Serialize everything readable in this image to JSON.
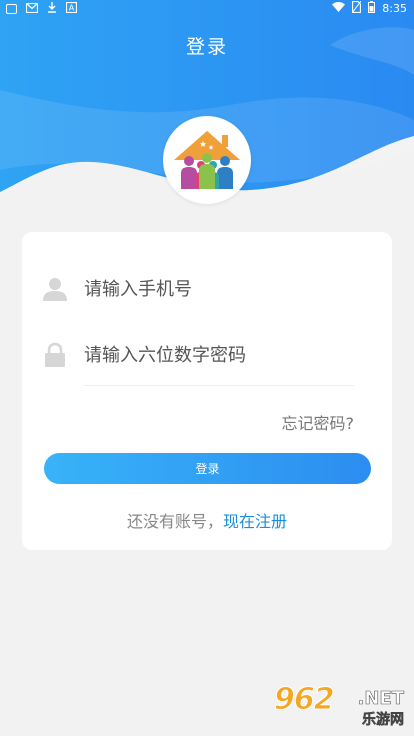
{
  "statusbar": {
    "time": "8:35",
    "left_icons": [
      "app-notification-icon",
      "mail-icon",
      "download-icon",
      "app-icon"
    ],
    "right_icons": [
      "wifi-icon",
      "no-sim-icon",
      "battery-icon"
    ]
  },
  "header": {
    "title": "登录"
  },
  "colors": {
    "primary_blue": "#2196f3",
    "button_gradient_start": "#38b3f8",
    "button_gradient_end": "#2c8df0",
    "link_blue": "#1a8fdc",
    "logo_orange": "#f0a038"
  },
  "logo": {
    "icon": "family-house-icon"
  },
  "form": {
    "username": {
      "icon": "user-icon",
      "placeholder": "请输入手机号",
      "value": ""
    },
    "password": {
      "icon": "lock-icon",
      "placeholder": "请输入六位数字密码",
      "value": ""
    },
    "forgot_label": "忘记密码?",
    "login_label": "登录",
    "register_prompt": "还没有账号，",
    "register_link": "现在注册"
  },
  "watermark": {
    "number": "962",
    "suffix": ".NET",
    "site": "乐游网"
  }
}
